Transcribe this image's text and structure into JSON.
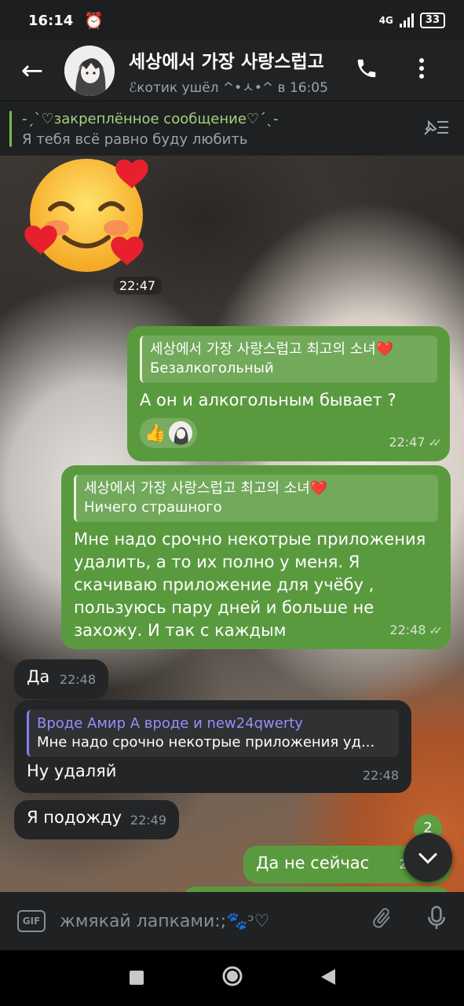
{
  "status_bar": {
    "time": "16:14",
    "alarm_icon": "alarm-icon",
    "network": "4G",
    "battery": "33"
  },
  "header": {
    "title": "세상에서 가장 사랑스럽고",
    "subtitle": "ℰкотик ушёл ^•ㅅ•^ в 16:05",
    "back_icon": "arrow-left-icon",
    "call_icon": "phone-icon",
    "menu_icon": "more-vertical-icon"
  },
  "pinned": {
    "title": "-ˏˋ♡закреплённое сообщение♡ˊˎ-",
    "text": "Я тебя всё равно буду любить",
    "icon": "unpin-list-icon"
  },
  "messages": [
    {
      "type": "sticker",
      "emoji": "🥰",
      "time": "22:47"
    },
    {
      "type": "out",
      "reply_name": "세상에서 가장 사랑스럽고 최고의 소녀❤️",
      "reply_text": "Безалкогольный",
      "text": "А он  и алкогольным бывает ?",
      "reactions": [
        "👍"
      ],
      "time": "22:47"
    },
    {
      "type": "out",
      "reply_name": "세상에서 가장 사랑스럽고 최고의 소녀❤️",
      "reply_text": "Ничего страшного",
      "text": "Мне надо срочно некотрые приложения удалить, а то их полно у меня. Я скачиваю приложение для учёбу , пользуюсь пару дней и больше не захожу. И так с каждым",
      "time": "22:48"
    },
    {
      "type": "in",
      "text": "Да",
      "time": "22:48"
    },
    {
      "type": "in",
      "reply_name": "Вроде Амир А вроде и new24qwerty",
      "reply_text": "Мне надо срочно некотрые приложения уд...",
      "text": "Ну удаляй",
      "time": "22:48"
    },
    {
      "type": "in",
      "text": "Я подожду",
      "time": "22:49"
    },
    {
      "type": "out",
      "text": "Да не сейчас",
      "time": "22:4"
    }
  ],
  "scroll_badge": "2",
  "input": {
    "gif_label": "GIF",
    "placeholder": "жмякай лапками:;🐾ᵓ♡",
    "attach_icon": "paperclip-icon",
    "mic_icon": "microphone-icon"
  },
  "nav": {
    "recent_icon": "square-icon",
    "home_icon": "circle-icon",
    "back_icon": "triangle-back-icon"
  },
  "colors": {
    "outgoing_bubble": "#5a9a3f",
    "incoming_bubble": "#232527",
    "accent": "#7bb94d",
    "reply_name_in": "#9b8cff"
  }
}
